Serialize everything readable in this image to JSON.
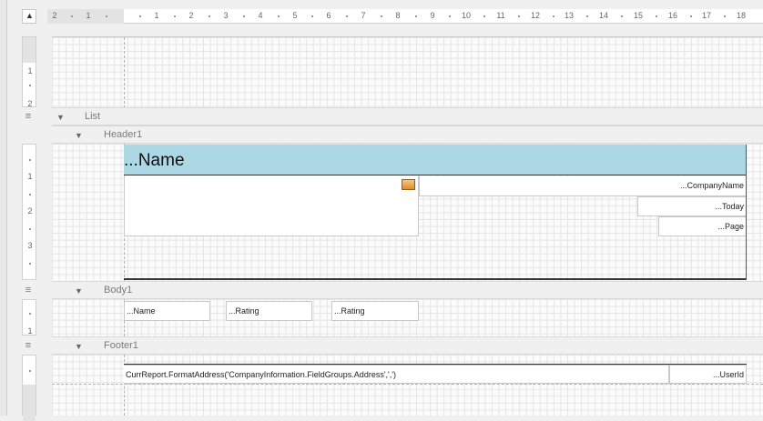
{
  "ruler": {
    "corner_icon": "triangle-up-icon",
    "top_labels": [
      "2",
      "1",
      "1",
      "2",
      "3",
      "4",
      "5",
      "6",
      "7",
      "8",
      "9",
      "10",
      "11",
      "12",
      "13",
      "14",
      "15",
      "16",
      "17",
      "18"
    ],
    "left_labels_top": [
      "1",
      "2"
    ],
    "left_labels_header": [
      "1",
      "2",
      "3"
    ],
    "left_labels_body": [
      "1"
    ]
  },
  "bands": {
    "list": {
      "label": "List"
    },
    "header": {
      "label": "Header1"
    },
    "body": {
      "label": "Body1"
    },
    "footer": {
      "label": "Footer1"
    }
  },
  "header_fields": {
    "title": "...Name",
    "company_name": "...CompanyName",
    "today": "...Today",
    "page": "...Page",
    "picture_icon": "image-icon"
  },
  "body_fields": {
    "name": "...Name",
    "rating1": "...Rating",
    "rating2": "...Rating"
  },
  "footer_fields": {
    "address": "CurrReport.FormatAddress('CompanyInformation.FieldGroups.Address',',')",
    "userid": "...UserId"
  },
  "colors": {
    "title_band": "#acd8e6"
  }
}
